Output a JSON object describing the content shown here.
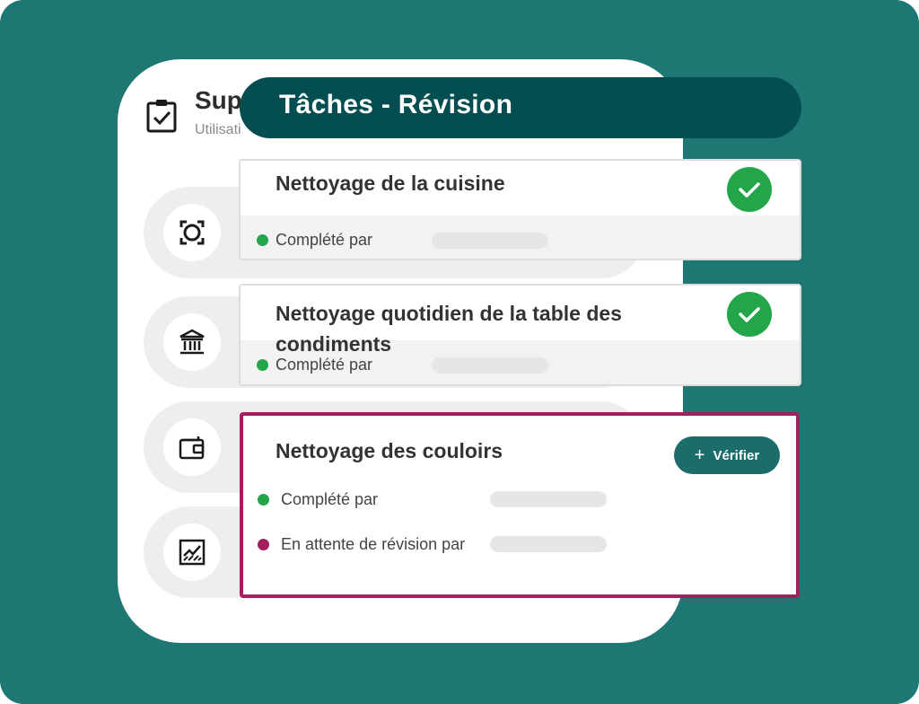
{
  "back_panel": {
    "title": "Sup",
    "subtitle": "Utilisati",
    "nav_icons": [
      "scan-frame-icon",
      "bank-icon",
      "wallet-icon",
      "chart-icon"
    ]
  },
  "header": {
    "title": "Tâches - Révision",
    "background": "#044e51"
  },
  "tasks": [
    {
      "title": "Nettoyage de la cuisine",
      "status": "completed",
      "completed_label": "Complété par"
    },
    {
      "title": "Nettoyage quotidien de la table des condiments",
      "status": "completed",
      "completed_label": "Complété par"
    }
  ],
  "active_task": {
    "title": "Nettoyage des couloirs",
    "verify_button": "Vérifier",
    "completed_label": "Complété par",
    "pending_label": "En attente de révision par",
    "border_color": "#a31f5e"
  },
  "colors": {
    "background": "#1f7773",
    "completed_dot": "#23a64a",
    "pending_dot": "#a31f5e",
    "check_badge": "#23a64a",
    "verify_button": "#1b6d6c"
  }
}
